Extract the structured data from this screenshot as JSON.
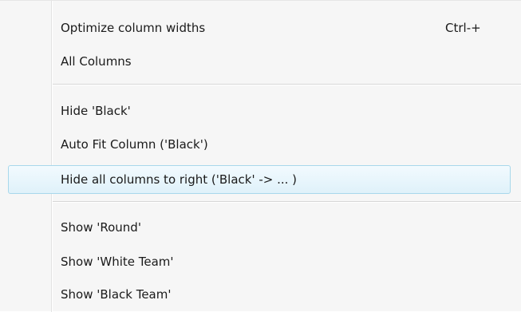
{
  "menu": {
    "items": [
      {
        "label": "Optimize column widths",
        "shortcut": "Ctrl-+"
      },
      {
        "label": "All Columns"
      },
      {
        "label": "Hide 'Black'"
      },
      {
        "label": "Auto Fit Column ('Black')"
      },
      {
        "label": "Hide all columns to right ('Black' -> ... )"
      },
      {
        "label": "Show 'Round'"
      },
      {
        "label": "Show 'White Team'"
      },
      {
        "label": "Show 'Black Team'"
      }
    ]
  },
  "colors": {
    "menu_background": "#f6f6f6",
    "highlight_border": "#a8d8eb",
    "highlight_fill": "#dff1fa",
    "text": "#1a1a1a"
  }
}
